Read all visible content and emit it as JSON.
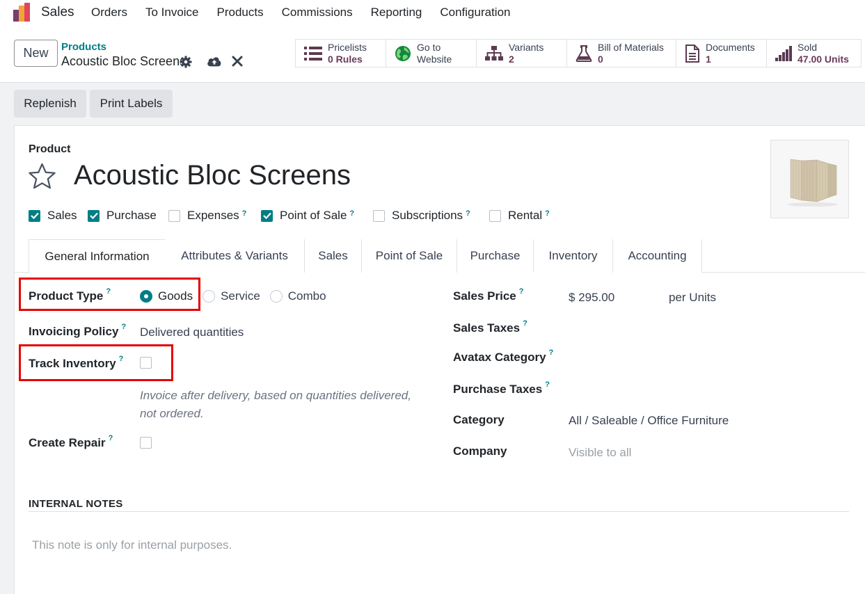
{
  "navbar": {
    "app_name": "Sales",
    "menu": [
      "Orders",
      "To Invoice",
      "Products",
      "Commissions",
      "Reporting",
      "Configuration"
    ]
  },
  "control": {
    "new_label": "New",
    "breadcrumb": "Products",
    "record_name": "Acoustic Bloc Screens"
  },
  "smart_buttons": [
    {
      "label": "Pricelists",
      "value": "0  Rules",
      "icon": "list-icon"
    },
    {
      "label": "Go to",
      "value": "Website",
      "icon": "globe-icon"
    },
    {
      "label": "Variants",
      "value": "2",
      "icon": "sitemap-icon"
    },
    {
      "label": "Bill of Materials",
      "value": "0",
      "icon": "flask-icon"
    },
    {
      "label": "Documents",
      "value": "1",
      "icon": "document-icon"
    },
    {
      "label": "Sold",
      "value": "47.00 Units",
      "icon": "signal-icon"
    }
  ],
  "actions": {
    "replenish": "Replenish",
    "print_labels": "Print Labels"
  },
  "form": {
    "product_label": "Product",
    "title": "Acoustic Bloc Screens",
    "checkboxes": [
      {
        "label": "Sales",
        "checked": true,
        "help": false
      },
      {
        "label": "Purchase",
        "checked": true,
        "help": false
      },
      {
        "label": "Expenses",
        "checked": false,
        "help": true
      },
      {
        "label": "Point of Sale",
        "checked": true,
        "help": true
      },
      {
        "label": "Subscriptions",
        "checked": false,
        "help": true
      },
      {
        "label": "Rental",
        "checked": false,
        "help": true
      }
    ],
    "help_mark": "?",
    "tabs": [
      "General Information",
      "Attributes & Variants",
      "Sales",
      "Point of Sale",
      "Purchase",
      "Inventory",
      "Accounting"
    ],
    "left": {
      "product_type_label": "Product Type",
      "product_type_options": [
        "Goods",
        "Service",
        "Combo"
      ],
      "product_type_selected": "Goods",
      "invoicing_policy_label": "Invoicing Policy",
      "invoicing_policy_value": "Delivered quantities",
      "track_inventory_label": "Track Inventory",
      "track_inventory_checked": false,
      "help_text": "Invoice after delivery, based on quantities delivered, not ordered.",
      "create_repair_label": "Create Repair",
      "create_repair_checked": false
    },
    "right": {
      "sales_price_label": "Sales Price",
      "sales_price_value": "$ 295.00",
      "sales_price_unit": "per Units",
      "sales_taxes_label": "Sales Taxes",
      "avatax_label": "Avatax Category",
      "purchase_taxes_label": "Purchase Taxes",
      "category_label": "Category",
      "category_value": "All / Saleable / Office Furniture",
      "company_label": "Company",
      "company_value": "Visible to all"
    },
    "notes_title": "INTERNAL NOTES",
    "notes_placeholder": "This note is only for internal purposes."
  },
  "colors": {
    "accent": "#017e84",
    "brand": "#714b67",
    "highlight": "#e50000"
  }
}
